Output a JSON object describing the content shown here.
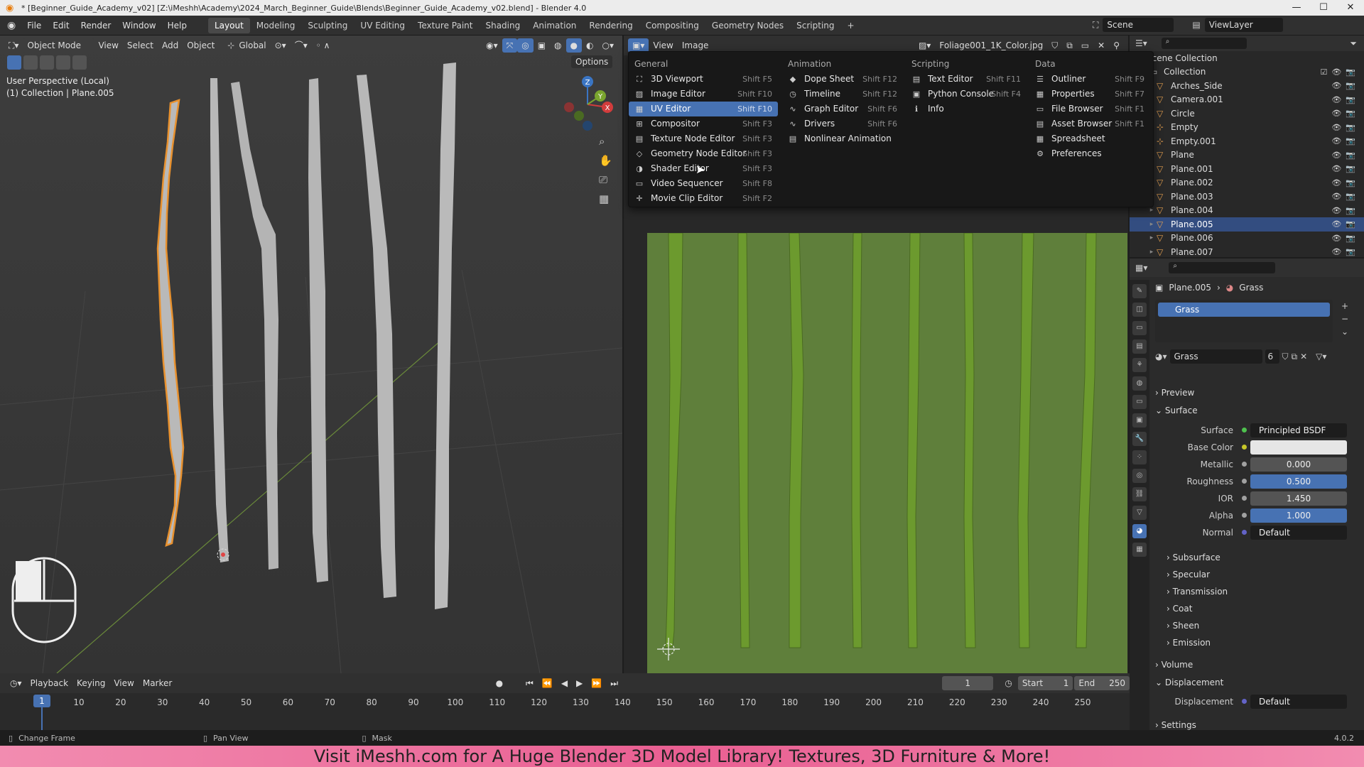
{
  "window": {
    "title": "* [Beginner_Guide_Academy_v02] [Z:\\iMeshh\\Academy\\2024_March_Beginner_Guide\\Blends\\Beginner_Guide_Academy_v02.blend] - Blender 4.0",
    "controls": [
      "—",
      "☐",
      "✕"
    ]
  },
  "menubar": [
    "File",
    "Edit",
    "Render",
    "Window",
    "Help"
  ],
  "workspaces": [
    "Layout",
    "Modeling",
    "Sculpting",
    "UV Editing",
    "Texture Paint",
    "Shading",
    "Animation",
    "Rendering",
    "Compositing",
    "Geometry Nodes",
    "Scripting",
    "+"
  ],
  "scene": {
    "label": "Scene",
    "view_layer": "ViewLayer"
  },
  "viewport": {
    "mode": "Object Mode",
    "menus": [
      "View",
      "Select",
      "Add",
      "Object"
    ],
    "transform": "Global",
    "options": "Options",
    "overlay_line1": "User Perspective (Local)",
    "overlay_line2": "(1) Collection | Plane.005",
    "gizmo_axes": [
      "Z",
      "Y",
      "X"
    ]
  },
  "uv_editor": {
    "menus": [
      "View",
      "Image"
    ],
    "image_name": "Foliage001_1K_Color.jpg"
  },
  "editor_menu": {
    "columns": [
      {
        "heading": "General",
        "items": [
          {
            "label": "3D Viewport",
            "shortcut": "Shift F5",
            "icon": "viewport-icon"
          },
          {
            "label": "Image Editor",
            "shortcut": "Shift F10",
            "icon": "image-icon"
          },
          {
            "label": "UV Editor",
            "shortcut": "Shift F10",
            "icon": "uv-icon"
          },
          {
            "label": "Compositor",
            "shortcut": "Shift F3",
            "icon": "compositor-icon"
          },
          {
            "label": "Texture Node Editor",
            "shortcut": "Shift F3",
            "icon": "texture-node-icon"
          },
          {
            "label": "Geometry Node Editor",
            "shortcut": "Shift F3",
            "icon": "geometry-node-icon"
          },
          {
            "label": "Shader Editor",
            "shortcut": "Shift F3",
            "icon": "shader-icon"
          },
          {
            "label": "Video Sequencer",
            "shortcut": "Shift F8",
            "icon": "sequencer-icon"
          },
          {
            "label": "Movie Clip Editor",
            "shortcut": "Shift F2",
            "icon": "clip-icon"
          }
        ]
      },
      {
        "heading": "Animation",
        "items": [
          {
            "label": "Dope Sheet",
            "shortcut": "Shift F12",
            "icon": "dopesheet-icon"
          },
          {
            "label": "Timeline",
            "shortcut": "Shift F12",
            "icon": "timeline-icon"
          },
          {
            "label": "Graph Editor",
            "shortcut": "Shift F6",
            "icon": "graph-icon"
          },
          {
            "label": "Drivers",
            "shortcut": "Shift F6",
            "icon": "drivers-icon"
          },
          {
            "label": "Nonlinear Animation",
            "shortcut": "",
            "icon": "nla-icon"
          }
        ]
      },
      {
        "heading": "Scripting",
        "items": [
          {
            "label": "Text Editor",
            "shortcut": "Shift F11",
            "icon": "text-icon"
          },
          {
            "label": "Python Console",
            "shortcut": "Shift F4",
            "icon": "console-icon"
          },
          {
            "label": "Info",
            "shortcut": "",
            "icon": "info-icon"
          }
        ]
      },
      {
        "heading": "Data",
        "items": [
          {
            "label": "Outliner",
            "shortcut": "Shift F9",
            "icon": "outliner-icon"
          },
          {
            "label": "Properties",
            "shortcut": "Shift F7",
            "icon": "properties-icon"
          },
          {
            "label": "File Browser",
            "shortcut": "Shift F1",
            "icon": "filebrowser-icon"
          },
          {
            "label": "Asset Browser",
            "shortcut": "Shift F1",
            "icon": "asset-icon"
          },
          {
            "label": "Spreadsheet",
            "shortcut": "",
            "icon": "spreadsheet-icon"
          },
          {
            "label": "Preferences",
            "shortcut": "",
            "icon": "preferences-icon"
          }
        ]
      }
    ],
    "highlighted": "UV Editor"
  },
  "outliner": {
    "root": "Scene Collection",
    "collection": "Collection",
    "items": [
      "Arches_Side",
      "Camera.001",
      "Circle",
      "Empty",
      "Empty.001",
      "Plane",
      "Plane.001",
      "Plane.002",
      "Plane.003",
      "Plane.004",
      "Plane.005",
      "Plane.006",
      "Plane.007"
    ],
    "selected": "Plane.005"
  },
  "properties": {
    "breadcrumb_object": "Plane.005",
    "breadcrumb_material": "Grass",
    "slot": "Grass",
    "material_name": "Grass",
    "users": "6",
    "preview": "Preview",
    "surface_header": "Surface",
    "surface_label": "Surface",
    "surface_value": "Principled BSDF",
    "fields": [
      {
        "label": "Base Color",
        "value": "",
        "style": "white",
        "dot": "#c7c729"
      },
      {
        "label": "Metallic",
        "value": "0.000",
        "style": "grey",
        "dot": "#a1a1a1"
      },
      {
        "label": "Roughness",
        "value": "0.500",
        "style": "blue",
        "dot": "#a1a1a1"
      },
      {
        "label": "IOR",
        "value": "1.450",
        "style": "grey",
        "dot": "#a1a1a1"
      },
      {
        "label": "Alpha",
        "value": "1.000",
        "style": "blue",
        "dot": "#a1a1a1"
      },
      {
        "label": "Normal",
        "value": "Default",
        "style": "dark",
        "dot": "#6363c7"
      }
    ],
    "subpanels": [
      "Subsurface",
      "Specular",
      "Transmission",
      "Coat",
      "Sheen",
      "Emission"
    ],
    "volume": "Volume",
    "displacement_header": "Displacement",
    "displacement_label": "Displacement",
    "displacement_value": "Default",
    "settings": "Settings"
  },
  "timeline": {
    "menus": [
      "Playback",
      "Keying",
      "View",
      "Marker"
    ],
    "current_frame": "1",
    "start_label": "Start",
    "start": "1",
    "end_label": "End",
    "end": "250",
    "ticks": [
      "1",
      "10",
      "20",
      "30",
      "40",
      "50",
      "60",
      "70",
      "80",
      "90",
      "100",
      "110",
      "120",
      "130",
      "140",
      "150",
      "160",
      "170",
      "180",
      "190",
      "200",
      "210",
      "220",
      "230",
      "240",
      "250"
    ]
  },
  "statusbar": {
    "items": [
      "Change Frame",
      "Pan View",
      "Mask"
    ],
    "version": "4.0.2"
  },
  "banner": "Visit iMeshh.com for A Huge Blender 3D Model Library! Textures, 3D Furniture & More!",
  "colors": {
    "accent": "#4772b3",
    "selection_outline": "#e8912e",
    "grass": "#5f7f3b"
  }
}
